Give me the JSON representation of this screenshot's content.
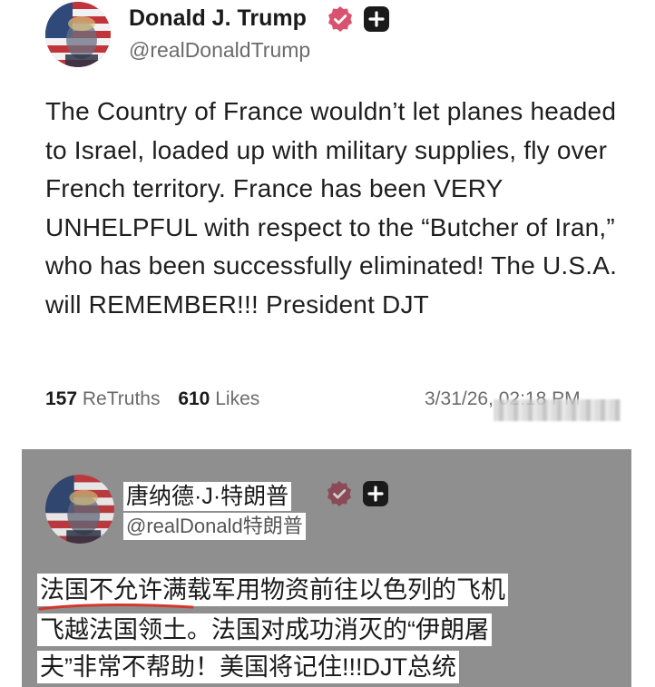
{
  "original_post": {
    "display_name": "Donald J. Trump",
    "handle": "@realDonaldTrump",
    "text": "The Country of France wouldn’t let planes headed to Israel, loaded up with military supplies, fly over French territory. France has been VERY UNHELPFUL with respect to the “Butcher of Iran,” who has been successfully eliminated! The U.S.A. will REMEMBER!!! President DJT",
    "retruths_count": "157",
    "retruths_label": "ReTruths",
    "likes_count": "610",
    "likes_label": "Likes",
    "timestamp": "3/31/26, 02:18 PM",
    "verified_badge_icon": "verified-badge-icon",
    "plus_icon": "plus-icon"
  },
  "translated_post": {
    "display_name": "唐纳德·J·特朗普",
    "handle": "@realDonald特朗普",
    "text_lines": [
      "法国不允许满载军用物资前往以色列的飞机",
      "飞越法国领土。法国对成功消灭的“伊朗屠",
      "夫”非常不帮助！美国将记住!!!DJT总统"
    ]
  },
  "colors": {
    "verified_badge": "#d9536f",
    "plus_badge": "#1a1a1a",
    "translated_background": "#8f8f8f",
    "underline": "#d2382e"
  }
}
